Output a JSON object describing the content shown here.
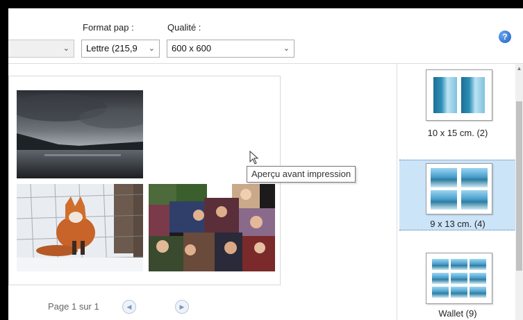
{
  "toolbar": {
    "first_select_value": "",
    "paper_label": "Format pap :",
    "paper_value": "Lettre (215,9",
    "quality_label": "Qualité :",
    "quality_value": "600 x 600",
    "help_glyph": "?"
  },
  "preview": {
    "tooltip": "Aperçu avant impression",
    "photos": [
      "lake-photo",
      "fox-photo",
      "collage-photo"
    ]
  },
  "pager": {
    "text": "Page 1 sur 1",
    "prev_glyph": "◀",
    "next_glyph": "▶"
  },
  "layouts": {
    "items": [
      {
        "label": "10 x 15 cm. (2)",
        "selected": false
      },
      {
        "label": "9 x 13 cm. (4)",
        "selected": true
      },
      {
        "label": "Wallet (9)",
        "selected": false
      }
    ]
  },
  "colors": {
    "selected_bg": "#cce4f7",
    "accent": "#1f5fbf"
  }
}
